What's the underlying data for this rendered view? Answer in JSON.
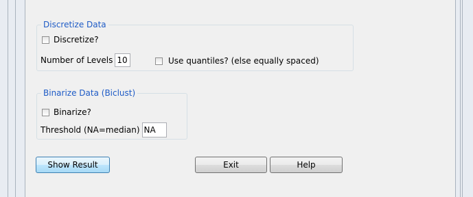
{
  "discretize": {
    "title": "Discretize Data",
    "checkbox_label": "Discretize?",
    "levels_label": "Number of Levels",
    "levels_value": "10",
    "quantiles_label": "Use quantiles? (else equally spaced)"
  },
  "binarize": {
    "title": "Binarize Data (Biclust)",
    "checkbox_label": "Binarize?",
    "threshold_label": "Threshold (NA=median)",
    "threshold_value": "NA"
  },
  "buttons": {
    "show_result": "Show Result",
    "exit": "Exit",
    "help": "Help"
  }
}
